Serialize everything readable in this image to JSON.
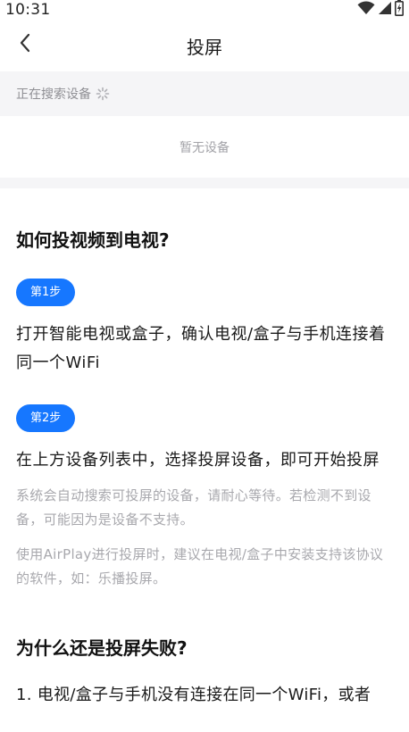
{
  "status_bar": {
    "time": "10:31",
    "icons": [
      "wifi-icon",
      "signal-icon",
      "battery-charging-icon"
    ]
  },
  "nav": {
    "title": "投屏",
    "back_icon": "chevron-left-icon"
  },
  "search": {
    "label": "正在搜索设备",
    "spinner_icon": "spinner-icon"
  },
  "device_list": {
    "empty_text": "暂无设备"
  },
  "guide": {
    "title": "如何投视频到电视?",
    "steps": [
      {
        "badge": "第1步",
        "text": "打开智能电视或盒子，确认电视/盒子与手机连接着同一个WiFi"
      },
      {
        "badge": "第2步",
        "text": "在上方设备列表中，选择投屏设备，即可开始投屏"
      }
    ],
    "notes": [
      "系统会自动搜索可投屏的设备，请耐心等待。若检测不到设备，可能因为是设备不支持。",
      "使用AirPlay进行投屏时，建议在电视/盒子中安装支持该协议的软件，如：乐播投屏。"
    ]
  },
  "why": {
    "title": "为什么还是投屏失败?",
    "reasons": [
      "1. 电视/盒子与手机没有连接在同一个WiFi，或者"
    ]
  },
  "colors": {
    "accent": "#1677ff",
    "background_gray": "#f5f5f7",
    "muted_text": "#a8a8ad"
  }
}
